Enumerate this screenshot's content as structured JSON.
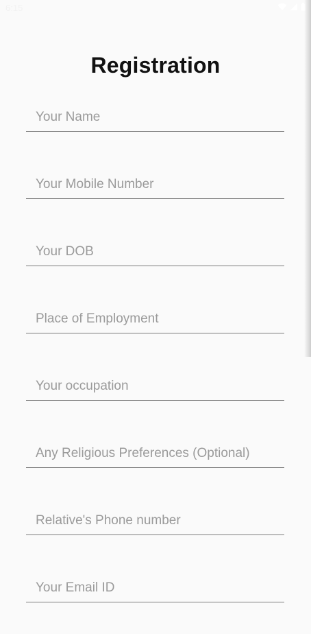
{
  "status_bar": {
    "time": "6:15",
    "icons": [
      "wifi-icon",
      "signal-icon",
      "battery-icon"
    ]
  },
  "page": {
    "title": "Registration"
  },
  "form": {
    "fields": [
      {
        "placeholder": "Your Name",
        "value": ""
      },
      {
        "placeholder": "Your Mobile Number",
        "value": ""
      },
      {
        "placeholder": "Your DOB",
        "value": ""
      },
      {
        "placeholder": "Place of Employment",
        "value": ""
      },
      {
        "placeholder": "Your occupation",
        "value": ""
      },
      {
        "placeholder": "Any Religious Preferences (Optional)",
        "value": ""
      },
      {
        "placeholder": "Relative's Phone number",
        "value": ""
      },
      {
        "placeholder": "Your Email ID",
        "value": ""
      }
    ]
  },
  "colors": {
    "background": "#fafafa",
    "title": "#111111",
    "placeholder": "#9a9a9a",
    "underline": "#7a7a7a"
  }
}
